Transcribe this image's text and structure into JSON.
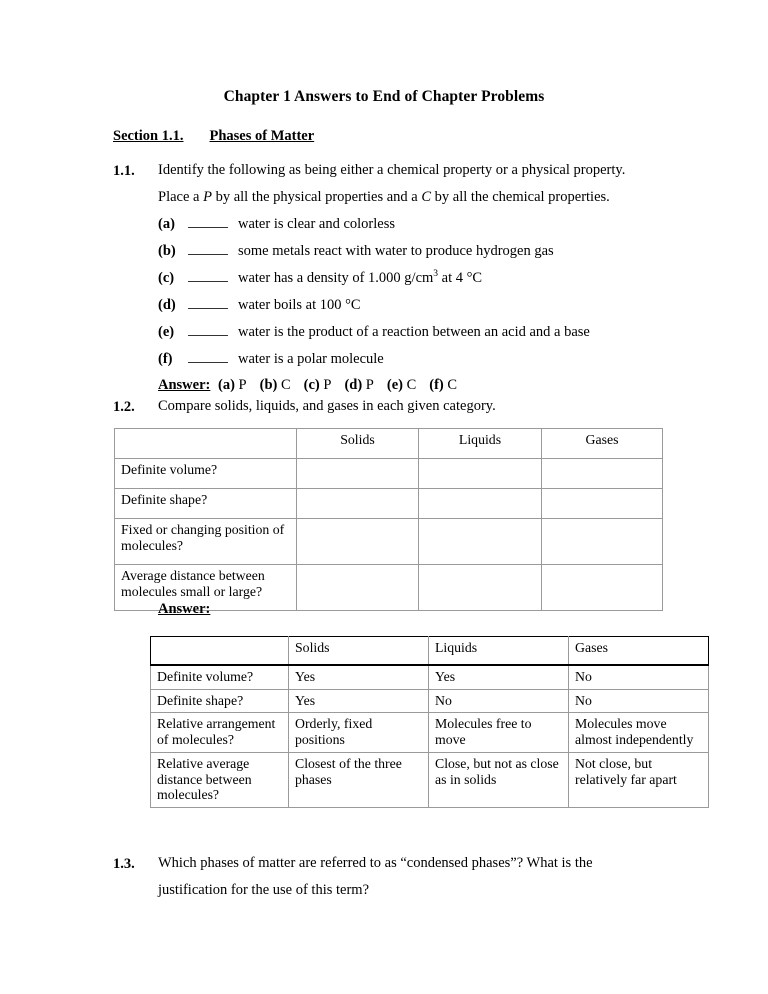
{
  "document": {
    "title": "Chapter 1 Answers to End of Chapter Problems",
    "section_label": "Section 1.1.",
    "section_title": "Phases of Matter"
  },
  "problem_1_1": {
    "number": "1.1.",
    "line1": "Identify the following as being either a chemical property or a physical property.",
    "line2_pre": "Place a ",
    "line2_italic_p": "P",
    "line2_mid": " by all the physical properties and a ",
    "line2_italic_c": "C",
    "line2_post": " by all the chemical properties.",
    "items": [
      {
        "label": "(a)",
        "text": "water is clear and colorless"
      },
      {
        "label": "(b)",
        "text": "some metals react with water to produce hydrogen gas"
      },
      {
        "label": "(c)",
        "text_pre": "water has a density of 1.000 g/cm",
        "sup": "3",
        "text_post": " at 4 °C"
      },
      {
        "label": "(d)",
        "text": "water boils at 100 °C"
      },
      {
        "label": "(e)",
        "text": "water is the product of a reaction between an acid and a base"
      },
      {
        "label": "(f)",
        "text": "water is a polar molecule"
      }
    ],
    "answer_label": "Answer:",
    "answers": [
      {
        "tag": "(a)",
        "value": "P"
      },
      {
        "tag": "(b)",
        "value": "C"
      },
      {
        "tag": "(c)",
        "value": "P"
      },
      {
        "tag": "(d)",
        "value": "P"
      },
      {
        "tag": "(e)",
        "value": "C"
      },
      {
        "tag": "(f)",
        "value": "C"
      }
    ]
  },
  "problem_1_2": {
    "number": "1.2.",
    "prompt": "Compare solids, liquids, and gases in each given category.",
    "answer_label": "Answer:",
    "blank_table": {
      "headers": [
        "",
        "Solids",
        "Liquids",
        "Gases"
      ],
      "rows": [
        {
          "category": "Definite volume?",
          "solids": "",
          "liquids": "",
          "gases": ""
        },
        {
          "category": "Definite shape?",
          "solids": "",
          "liquids": "",
          "gases": ""
        },
        {
          "category": "Fixed or changing position of molecules?",
          "solids": "",
          "liquids": "",
          "gases": ""
        },
        {
          "category": "Average distance between molecules small or large?",
          "solids": "",
          "liquids": "",
          "gases": ""
        }
      ]
    },
    "answer_table": {
      "headers": [
        "",
        "Solids",
        "Liquids",
        "Gases"
      ],
      "rows": [
        {
          "category": "Definite volume?",
          "solids": "Yes",
          "liquids": "Yes",
          "gases": "No"
        },
        {
          "category": "Definite shape?",
          "solids": "Yes",
          "liquids": "No",
          "gases": "No"
        },
        {
          "category": "Relative arrangement of molecules?",
          "solids": "Orderly, fixed positions",
          "liquids": "Molecules free to move",
          "gases": "Molecules move almost independently"
        },
        {
          "category": "Relative average distance between molecules?",
          "solids": "Closest of the three phases",
          "liquids": "Close, but not as close as in solids",
          "gases": "Not close, but relatively far apart"
        }
      ]
    }
  },
  "problem_1_3": {
    "number": "1.3.",
    "line1": "Which phases of matter are referred to as “condensed phases”? What is the",
    "line2": "justification for the use of this term?"
  }
}
